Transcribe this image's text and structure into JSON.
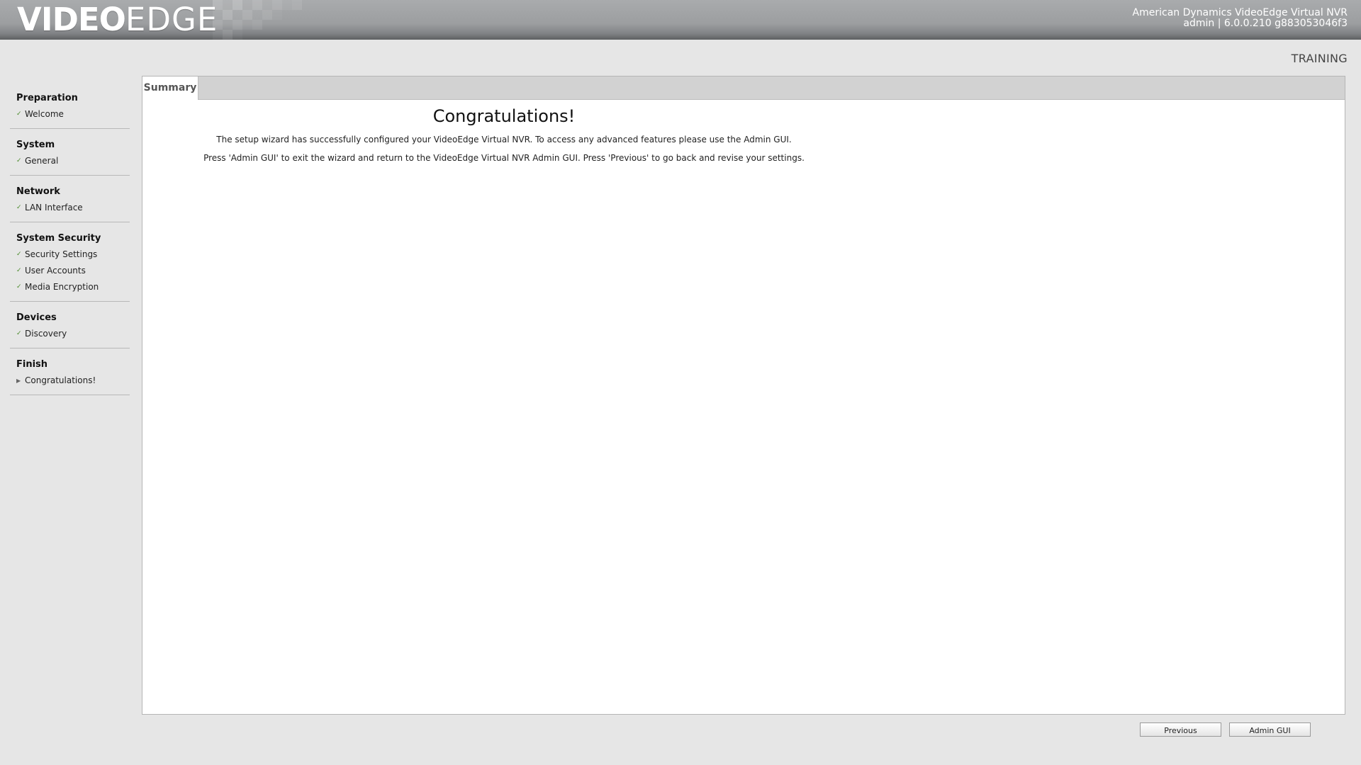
{
  "header": {
    "logo_bold": "VIDEO",
    "logo_thin": "EDGE",
    "product_line": "American Dynamics VideoEdge Virtual NVR",
    "user_line": "admin | 6.0.0.210 g883053046f3"
  },
  "mode_label": "TRAINING",
  "sidebar": {
    "sections": [
      {
        "title": "Preparation",
        "items": [
          {
            "label": "Welcome",
            "status": "done"
          }
        ]
      },
      {
        "title": "System",
        "items": [
          {
            "label": "General",
            "status": "done"
          }
        ]
      },
      {
        "title": "Network",
        "items": [
          {
            "label": "LAN Interface",
            "status": "done"
          }
        ]
      },
      {
        "title": "System Security",
        "items": [
          {
            "label": "Security Settings",
            "status": "done"
          },
          {
            "label": "User Accounts",
            "status": "done"
          },
          {
            "label": "Media Encryption",
            "status": "done"
          }
        ]
      },
      {
        "title": "Devices",
        "items": [
          {
            "label": "Discovery",
            "status": "done"
          }
        ]
      },
      {
        "title": "Finish",
        "items": [
          {
            "label": "Congratulations!",
            "status": "current"
          }
        ]
      }
    ]
  },
  "main": {
    "tab_label": "Summary",
    "title": "Congratulations!",
    "line1": "The setup wizard has successfully configured your VideoEdge Virtual NVR. To access any advanced features please use the Admin GUI.",
    "line2": "Press 'Admin GUI' to exit the wizard and return to the VideoEdge Virtual NVR Admin GUI. Press 'Previous' to go back and revise your settings."
  },
  "buttons": {
    "previous": "Previous",
    "admin_gui": "Admin GUI"
  },
  "icons": {
    "done": "check-icon",
    "current": "arrow-right-icon"
  },
  "colors": {
    "check": "#4a8a2a",
    "header_gray": "#9c9ea0",
    "background": "#e6e6e6"
  }
}
